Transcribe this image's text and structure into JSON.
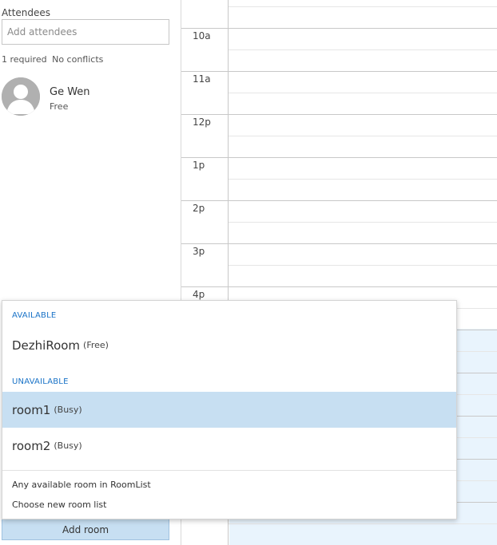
{
  "attendees": {
    "label": "Attendees",
    "input_placeholder": "Add attendees",
    "input_value": "",
    "required_text": "1 required",
    "conflicts_text": "No conflicts",
    "list": [
      {
        "name": "Ge Wen",
        "status": "Free",
        "avatar": "person-silhouette-icon"
      }
    ]
  },
  "calendar": {
    "hours": [
      "10a",
      "11a",
      "12p",
      "1p",
      "2p",
      "3p",
      "4p"
    ]
  },
  "room_dropdown": {
    "available_header": "AVAILABLE",
    "available": [
      {
        "name": "DezhiRoom",
        "tag": "(Free)"
      }
    ],
    "unavailable_header": "UNAVAILABLE",
    "unavailable": [
      {
        "name": "room1",
        "tag": "(Busy)",
        "selected": true
      },
      {
        "name": "room2",
        "tag": "(Busy)",
        "selected": false
      }
    ],
    "any_room_label": "Any available room in RoomList",
    "choose_list_label": "Choose new room list"
  },
  "add_room_label": "Add room",
  "colors": {
    "accent": "#1a73c7",
    "selected_bg": "#c7dff2",
    "busy_bg": "#e9f4fd"
  }
}
